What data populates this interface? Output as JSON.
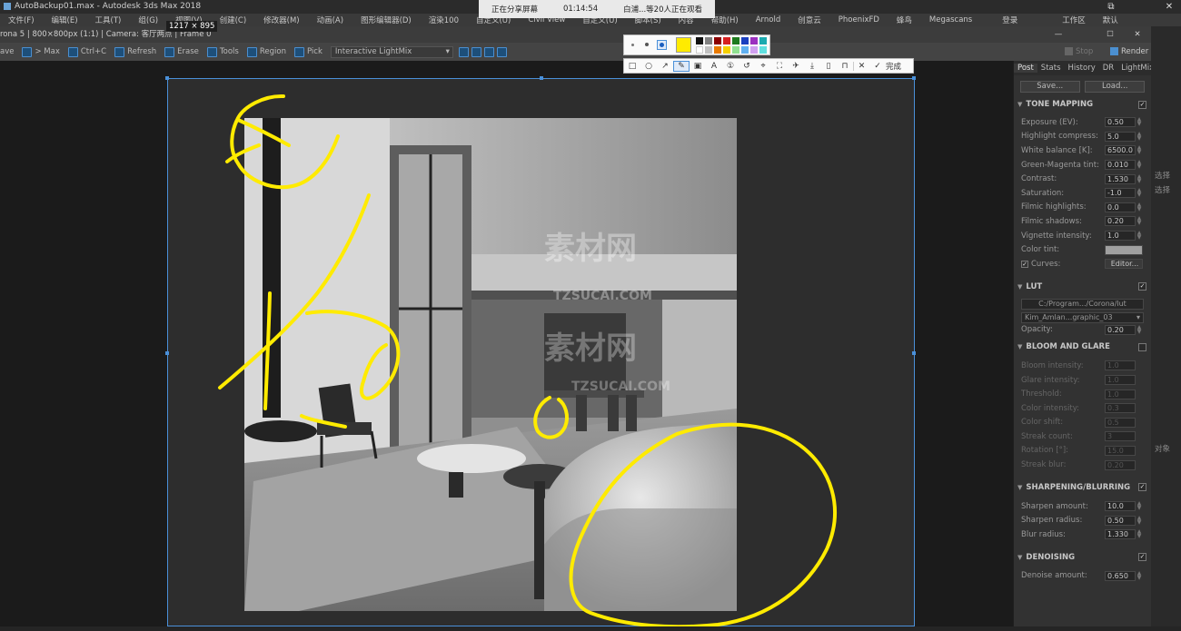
{
  "window": {
    "title": "AutoBackup01.max - Autodesk 3ds Max 2018"
  },
  "menu": [
    "文件(F)",
    "编辑(E)",
    "工具(T)",
    "组(G)",
    "视图(V)",
    "创建(C)",
    "修改器(M)",
    "动画(A)",
    "图形编辑器(D)",
    "渲染100",
    "自定义(U)",
    "Civil View",
    "自定义(U)",
    "脚本(S)",
    "内容",
    "帮助(H)",
    "Arnold",
    "创意云",
    "PhoenixFD",
    "蜂鸟",
    "Megascans"
  ],
  "menu_right": {
    "login": "登录",
    "workspace": "工作区",
    "default": "默认"
  },
  "share_bar": {
    "status": "正在分享屏幕",
    "time": "01:14:54",
    "viewers": "白浦...等20人正在观看"
  },
  "size_label": "1217 × 895",
  "frame_header": "rona 5 | 800×800px (1:1) | Camera: 客厅两点 | Frame 0",
  "toolbar": {
    "items": [
      {
        "label": "ave",
        "icon": ""
      },
      {
        "label": "> Max",
        "icon": "max-icon"
      },
      {
        "label": "Ctrl+C",
        "icon": "copy-icon"
      },
      {
        "label": "Refresh",
        "icon": "refresh-icon"
      },
      {
        "label": "Erase",
        "icon": "erase-icon"
      },
      {
        "label": "Tools",
        "icon": "tools-icon"
      },
      {
        "label": "Region",
        "icon": "region-icon"
      },
      {
        "label": "Pick",
        "icon": "pick-icon"
      }
    ],
    "lightmix": "Interactive LightMix",
    "stop": "Stop",
    "render": "Render"
  },
  "panel": {
    "tabs": [
      "Post",
      "Stats",
      "History",
      "DR",
      "LightMix"
    ],
    "save": "Save...",
    "load": "Load...",
    "tone_mapping": {
      "title": "TONE MAPPING",
      "rows": [
        {
          "label": "Exposure (EV):",
          "value": "0.50"
        },
        {
          "label": "Highlight compress:",
          "value": "5.0"
        },
        {
          "label": "White balance [K]:",
          "value": "6500.0"
        },
        {
          "label": "Green-Magenta tint:",
          "value": "0.010"
        },
        {
          "label": "Contrast:",
          "value": "1.530"
        },
        {
          "label": "Saturation:",
          "value": "-1.0"
        },
        {
          "label": "Filmic highlights:",
          "value": "0.0"
        },
        {
          "label": "Filmic shadows:",
          "value": "0.20"
        },
        {
          "label": "Vignette intensity:",
          "value": "1.0"
        },
        {
          "label": "Color tint:",
          "value": ""
        },
        {
          "label": "Curves:",
          "value": "Editor..."
        }
      ]
    },
    "lut": {
      "title": "LUT",
      "path": "C:/Program.../Corona/lut",
      "file": "Kim_Amlan...graphic_03",
      "opacity_label": "Opacity:",
      "opacity": "0.20"
    },
    "bloom": {
      "title": "BLOOM AND GLARE",
      "rows": [
        {
          "label": "Bloom intensity:",
          "value": "1.0"
        },
        {
          "label": "Glare intensity:",
          "value": "1.0"
        },
        {
          "label": "Threshold:",
          "value": "1.0"
        },
        {
          "label": "Color intensity:",
          "value": "0.3"
        },
        {
          "label": "Color shift:",
          "value": "0.5"
        },
        {
          "label": "Streak count:",
          "value": "3"
        },
        {
          "label": "Rotation [°]:",
          "value": "15.0"
        },
        {
          "label": "Streak blur:",
          "value": "0.20"
        }
      ]
    },
    "sharpen": {
      "title": "SHARPENING/BLURRING",
      "rows": [
        {
          "label": "Sharpen amount:",
          "value": "10.0"
        },
        {
          "label": "Sharpen radius:",
          "value": "0.50"
        },
        {
          "label": "Blur radius:",
          "value": "1.330"
        }
      ]
    },
    "denoise": {
      "title": "DENOISING",
      "rows": [
        {
          "label": "Denoise amount:",
          "value": "0.650"
        }
      ]
    }
  },
  "annotation": {
    "finish": "完成",
    "colors": [
      "#ffeb00",
      "#111111",
      "#808080",
      "#8b0000",
      "#d62020",
      "#e87a00",
      "#1e7a1e",
      "#1a3fbf",
      "#9b30c0",
      "#1aaab0",
      "#ffffff",
      "#c0c0c0",
      "#e0a0a0",
      "#ffb0b0",
      "#f5d000",
      "#90e090",
      "#60b0f0",
      "#d0a0f0",
      "#60e0e0"
    ],
    "pen_color": "#ffeb00"
  },
  "watermark": {
    "cn": "素材网",
    "en": "TZSUCAI.COM"
  },
  "far_right": [
    "选择",
    "选择",
    "对象"
  ]
}
